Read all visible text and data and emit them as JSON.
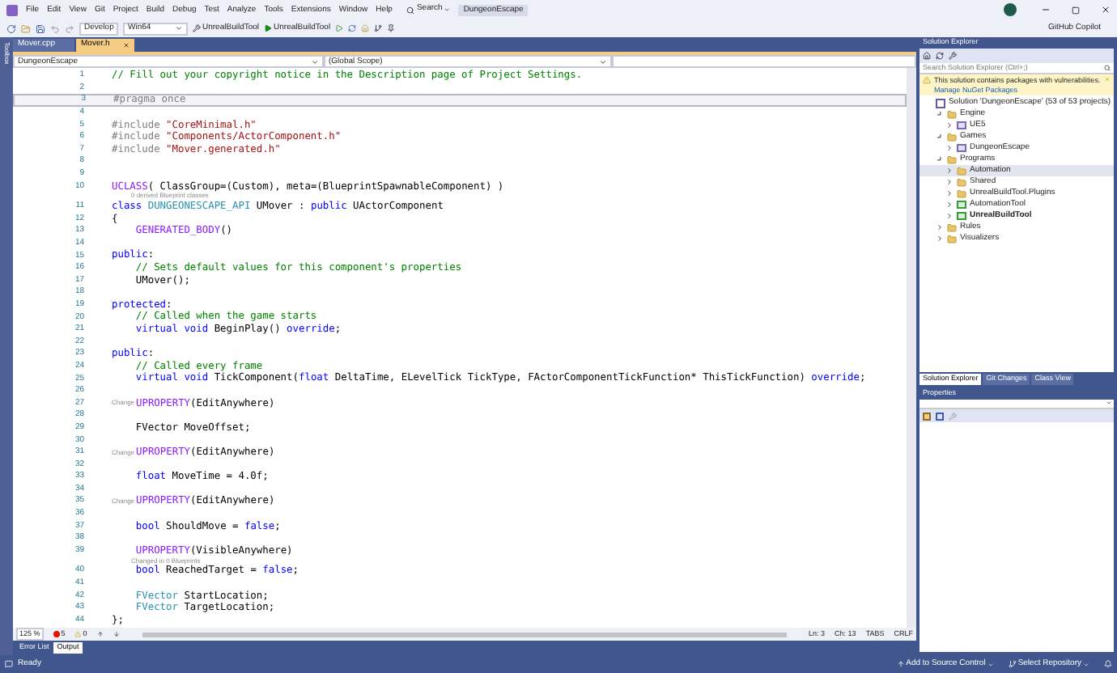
{
  "menu": {
    "items": [
      "File",
      "Edit",
      "View",
      "Git",
      "Project",
      "Build",
      "Debug",
      "Test",
      "Analyze",
      "Tools",
      "Extensions",
      "Window",
      "Help"
    ],
    "search": "Search",
    "solution_title": "DungeonEscape"
  },
  "toolbar": {
    "configuration": "Develop",
    "platform": "Win64",
    "startup_project": "UnrealBuildTool",
    "run_target": "UnrealBuildTool"
  },
  "account": {
    "copilot": "GitHub Copilot"
  },
  "left_strip": {
    "label": "Toolbox"
  },
  "editor": {
    "tabs": [
      {
        "label": "Mover.cpp",
        "selected": false
      },
      {
        "label": "Mover.h",
        "selected": true
      }
    ],
    "nav": {
      "project": "DungeonEscape",
      "scope": "(Global Scope)"
    },
    "lines": [
      {
        "kind": "code",
        "number": "1",
        "current": false,
        "tokens": [
          {
            "kind": "comment",
            "text": "// Fill out your copyright notice in the Description page of Project Settings."
          }
        ]
      },
      {
        "kind": "code",
        "number": "2",
        "current": false
      },
      {
        "kind": "code",
        "number": "3",
        "current": true,
        "tokens": [
          {
            "kind": "preproc",
            "text": "#pragma once"
          }
        ]
      },
      {
        "kind": "code",
        "number": "4",
        "current": false
      },
      {
        "kind": "code",
        "number": "5",
        "current": false,
        "tokens": [
          {
            "kind": "preproc",
            "text": "#include "
          },
          {
            "kind": "string",
            "text": "\"CoreMinimal.h\""
          }
        ]
      },
      {
        "kind": "code",
        "number": "6",
        "current": false,
        "tokens": [
          {
            "kind": "preproc",
            "text": "#include "
          },
          {
            "kind": "string",
            "text": "\"Components/ActorComponent.h\""
          }
        ]
      },
      {
        "kind": "code",
        "number": "7",
        "current": false,
        "tokens": [
          {
            "kind": "preproc",
            "text": "#include "
          },
          {
            "kind": "string",
            "text": "\"Mover.generated.h\""
          }
        ]
      },
      {
        "kind": "code",
        "number": "8",
        "current": false
      },
      {
        "kind": "code",
        "number": "9",
        "current": false
      },
      {
        "kind": "code",
        "number": "10",
        "current": false,
        "tokens": [
          {
            "kind": "macro",
            "text": "UCLASS"
          },
          {
            "kind": "plain",
            "text": "( ClassGroup=(Custom), meta=(BlueprintSpawnableComponent) )"
          }
        ]
      },
      {
        "kind": "lens",
        "text": "0 derived Blueprint classes"
      },
      {
        "kind": "code",
        "number": "11",
        "current": false,
        "tokens": [
          {
            "kind": "keyword",
            "text": "class "
          },
          {
            "kind": "type",
            "text": "DUNGEONESCAPE_API"
          },
          {
            "kind": "plain",
            "text": " UMover : "
          },
          {
            "kind": "keyword",
            "text": "public"
          },
          {
            "kind": "plain",
            "text": " UActorComponent"
          }
        ]
      },
      {
        "kind": "code",
        "number": "12",
        "current": false,
        "tokens": [
          {
            "kind": "plain",
            "text": "{"
          }
        ]
      },
      {
        "kind": "code",
        "number": "13",
        "current": false,
        "tokens": [
          {
            "kind": "macro",
            "text": "    GENERATED_BODY"
          },
          {
            "kind": "plain",
            "text": "()"
          }
        ]
      },
      {
        "kind": "code",
        "number": "14",
        "current": false
      },
      {
        "kind": "code",
        "number": "15",
        "current": false,
        "tokens": [
          {
            "kind": "keyword",
            "text": "public"
          },
          {
            "kind": "plain",
            "text": ":"
          }
        ]
      },
      {
        "kind": "code",
        "number": "16",
        "current": false,
        "tokens": [
          {
            "kind": "comment",
            "text": "    // Sets default values for this component's properties"
          }
        ]
      },
      {
        "kind": "code",
        "number": "17",
        "current": false,
        "tokens": [
          {
            "kind": "plain",
            "text": "    UMover();"
          }
        ]
      },
      {
        "kind": "code",
        "number": "18",
        "current": false
      },
      {
        "kind": "code",
        "number": "19",
        "current": false,
        "tokens": [
          {
            "kind": "keyword",
            "text": "protected"
          },
          {
            "kind": "plain",
            "text": ":"
          }
        ]
      },
      {
        "kind": "code",
        "number": "20",
        "current": false,
        "tokens": [
          {
            "kind": "comment",
            "text": "    // Called when the game starts"
          }
        ]
      },
      {
        "kind": "code",
        "number": "21",
        "current": false,
        "tokens": [
          {
            "kind": "keyword",
            "text": "    virtual void"
          },
          {
            "kind": "plain",
            "text": " BeginPlay() "
          },
          {
            "kind": "keyword",
            "text": "override"
          },
          {
            "kind": "plain",
            "text": ";"
          }
        ]
      },
      {
        "kind": "code",
        "number": "22",
        "current": false
      },
      {
        "kind": "code",
        "number": "23",
        "current": false,
        "tokens": [
          {
            "kind": "keyword",
            "text": "public"
          },
          {
            "kind": "plain",
            "text": ":"
          }
        ]
      },
      {
        "kind": "code",
        "number": "24",
        "current": false,
        "tokens": [
          {
            "kind": "comment",
            "text": "    // Called every frame"
          }
        ]
      },
      {
        "kind": "code",
        "number": "25",
        "current": false,
        "tokens": [
          {
            "kind": "keyword",
            "text": "    virtual void"
          },
          {
            "kind": "plain",
            "text": " TickComponent("
          },
          {
            "kind": "keyword",
            "text": "float"
          },
          {
            "kind": "plain",
            "text": " DeltaTime, ELevelTick TickType, FActorComponentTickFunction* ThisTickFunction) "
          },
          {
            "kind": "keyword",
            "text": "override"
          },
          {
            "kind": "plain",
            "text": ";"
          }
        ]
      },
      {
        "kind": "code",
        "number": "26",
        "current": false
      },
      {
        "kind": "code",
        "number": "27",
        "current": false,
        "lens_stub": "Change",
        "tokens": [
          {
            "kind": "macro",
            "text": "UPROPERTY"
          },
          {
            "kind": "plain",
            "text": "(EditAnywhere)"
          }
        ]
      },
      {
        "kind": "code",
        "number": "28",
        "current": false
      },
      {
        "kind": "code",
        "number": "29",
        "current": false,
        "tokens": [
          {
            "kind": "plain",
            "text": "    FVector MoveOffset;"
          }
        ]
      },
      {
        "kind": "code",
        "number": "30",
        "current": false
      },
      {
        "kind": "code",
        "number": "31",
        "current": false,
        "lens_stub": "Change",
        "tokens": [
          {
            "kind": "macro",
            "text": "UPROPERTY"
          },
          {
            "kind": "plain",
            "text": "(EditAnywhere)"
          }
        ]
      },
      {
        "kind": "code",
        "number": "32",
        "current": false
      },
      {
        "kind": "code",
        "number": "33",
        "current": false,
        "tokens": [
          {
            "kind": "keyword",
            "text": "    float"
          },
          {
            "kind": "plain",
            "text": " MoveTime = 4.0f;"
          }
        ]
      },
      {
        "kind": "code",
        "number": "34",
        "current": false
      },
      {
        "kind": "code",
        "number": "35",
        "current": false,
        "lens_stub": "Change",
        "tokens": [
          {
            "kind": "macro",
            "text": "UPROPERTY"
          },
          {
            "kind": "plain",
            "text": "(EditAnywhere)"
          }
        ]
      },
      {
        "kind": "code",
        "number": "36",
        "current": false
      },
      {
        "kind": "code",
        "number": "37",
        "current": false,
        "tokens": [
          {
            "kind": "keyword",
            "text": "    bool"
          },
          {
            "kind": "plain",
            "text": " ShouldMove = "
          },
          {
            "kind": "keyword",
            "text": "false"
          },
          {
            "kind": "plain",
            "text": ";"
          }
        ]
      },
      {
        "kind": "code",
        "number": "38",
        "current": false
      },
      {
        "kind": "code",
        "number": "39",
        "current": false,
        "tokens": [
          {
            "kind": "macro",
            "text": "    UPROPERTY"
          },
          {
            "kind": "plain",
            "text": "(VisibleAnywhere)"
          }
        ]
      },
      {
        "kind": "lens",
        "text": "Changed in 0 Blueprints"
      },
      {
        "kind": "code",
        "number": "40",
        "current": false,
        "tokens": [
          {
            "kind": "keyword",
            "text": "    bool"
          },
          {
            "kind": "plain",
            "text": " ReachedTarget = "
          },
          {
            "kind": "keyword",
            "text": "false"
          },
          {
            "kind": "plain",
            "text": ";"
          }
        ]
      },
      {
        "kind": "code",
        "number": "41",
        "current": false
      },
      {
        "kind": "code",
        "number": "42",
        "current": false,
        "tokens": [
          {
            "kind": "type",
            "text": "    FVector"
          },
          {
            "kind": "plain",
            "text": " StartLocation;"
          }
        ]
      },
      {
        "kind": "code",
        "number": "43",
        "current": false,
        "tokens": [
          {
            "kind": "type",
            "text": "    FVector"
          },
          {
            "kind": "plain",
            "text": " TargetLocation;"
          }
        ]
      },
      {
        "kind": "code",
        "number": "44",
        "current": false,
        "tokens": [
          {
            "kind": "plain",
            "text": "};"
          }
        ]
      }
    ],
    "status": {
      "zoom": "125 %",
      "errors": "5",
      "warnings": "0",
      "line": "Ln: 3",
      "column": "Ch: 13",
      "indent": "TABS",
      "line_endings": "CRLF"
    }
  },
  "bottom_tabs": [
    {
      "label": "Error List",
      "selected": false
    },
    {
      "label": "Output",
      "selected": true
    }
  ],
  "solution_explorer": {
    "title": "Solution Explorer",
    "search_placeholder": "Search Solution Explorer (Ctrl+;)",
    "warning": {
      "text": "This solution contains packages with vulnerabilities.",
      "link": "Manage NuGet Packages"
    },
    "tree": [
      {
        "label": "Solution 'DungeonEscape' (53 of 53 projects)",
        "kind": "solution",
        "selected": false,
        "startup": false,
        "children": [
          {
            "label": "Engine",
            "kind": "folder",
            "expanded": true,
            "selected": false,
            "startup": false,
            "children": [
              {
                "label": "UE5",
                "kind": "project",
                "expanded": false,
                "selected": false,
                "startup": false
              }
            ]
          },
          {
            "label": "Games",
            "kind": "folder",
            "expanded": true,
            "selected": false,
            "startup": false,
            "children": [
              {
                "label": "DungeonEscape",
                "kind": "project",
                "expanded": false,
                "selected": false,
                "startup": false
              }
            ]
          },
          {
            "label": "Programs",
            "kind": "folder",
            "expanded": true,
            "selected": false,
            "startup": false,
            "children": [
              {
                "label": "Automation",
                "kind": "folder",
                "expanded": false,
                "selected": true,
                "startup": false
              },
              {
                "label": "Shared",
                "kind": "folder",
                "expanded": false,
                "selected": false,
                "startup": false
              },
              {
                "label": "UnrealBuildTool.Plugins",
                "kind": "folder",
                "expanded": false,
                "selected": false,
                "startup": false
              },
              {
                "label": "AutomationTool",
                "kind": "csproject",
                "expanded": false,
                "selected": false,
                "startup": false
              },
              {
                "label": "UnrealBuildTool",
                "kind": "csproject",
                "expanded": false,
                "selected": false,
                "startup": true
              }
            ]
          },
          {
            "label": "Rules",
            "kind": "folder",
            "expanded": false,
            "selected": false,
            "startup": false
          },
          {
            "label": "Visualizers",
            "kind": "folder",
            "expanded": false,
            "selected": false,
            "startup": false
          }
        ]
      }
    ],
    "tabs": [
      {
        "label": "Solution Explorer",
        "selected": true
      },
      {
        "label": "Git Changes",
        "selected": false
      },
      {
        "label": "Class View",
        "selected": false
      }
    ]
  },
  "properties": {
    "title": "Properties"
  },
  "status_bar": {
    "text": "Ready",
    "source_control": "Add to Source Control",
    "repository": "Select Repository"
  }
}
